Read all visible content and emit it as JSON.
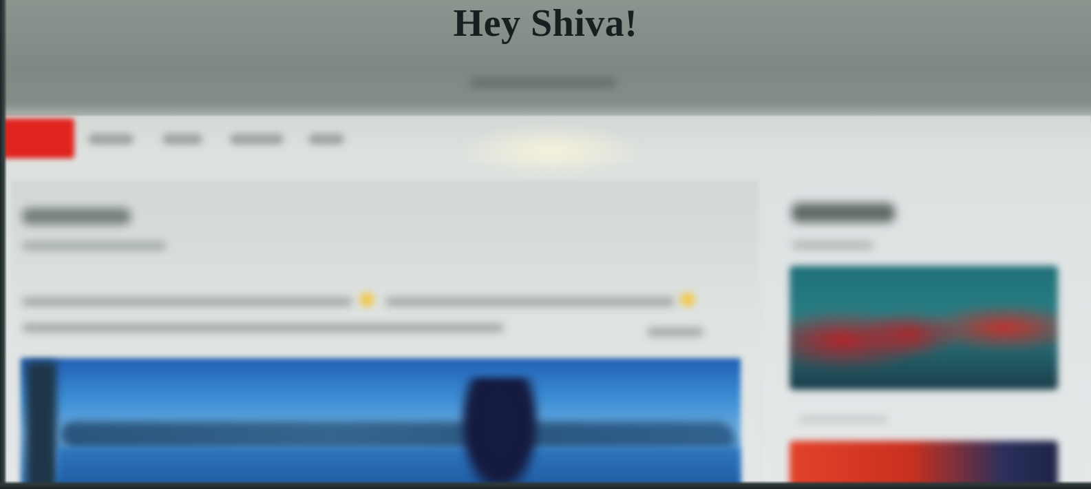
{
  "site": {
    "title": "Hey Shiva!"
  },
  "colors": {
    "header_background": "#838d88",
    "page_background": "#dde2e0",
    "nav_active": "#e0231e",
    "title_text": "#172020"
  },
  "nav": {
    "item_count": 5
  }
}
